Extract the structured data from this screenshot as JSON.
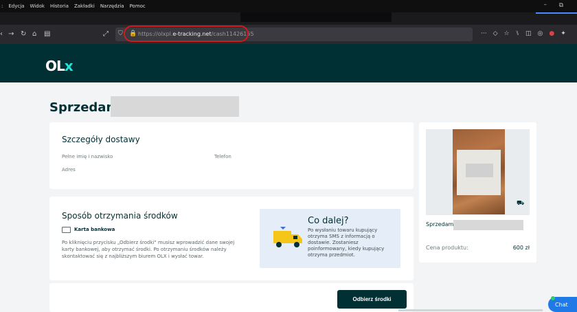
{
  "menubar": {
    "items": [
      ":",
      "Edycja",
      "Widok",
      "Historia",
      "Zakładki",
      "Narzędzia",
      "Pomoc"
    ]
  },
  "browser": {
    "url_prefix": "https://olxpl.",
    "url_domain": "e-tracking.net",
    "url_path": "/cash11426155"
  },
  "brand": {
    "logo_main": "OL",
    "logo_accent": "x"
  },
  "page": {
    "title": "Sprzedam"
  },
  "delivery": {
    "title": "Szczegóły dostawy",
    "fullname_label": "Pełne imię i nazwisko",
    "phone_label": "Telefon",
    "address_label": "Adres"
  },
  "payment": {
    "title": "Sposób otrzymania środków",
    "method_label": "Karta bankowa",
    "description": "Po kliknięciu przycisku „Odbierz środki\" musisz wprowadzić dane swojej karty bankowej, aby otrzymać środki. Po otrzymaniu środków należy skontaktować się z najbliższym biurem OLX i wysłać towar."
  },
  "next": {
    "title": "Co dalej?",
    "text": "Po wysłaniu towaru kupujący otrzyma SMS z informacją o dostawie. Zostaniesz poinformowany, kiedy kupujący otrzyma przedmiot."
  },
  "product": {
    "name": "Sprzedam",
    "price_label": "Cena produktu:",
    "price_value": "600 zł"
  },
  "actions": {
    "collect_label": "Odbierz środki",
    "chat_label": "Chat"
  },
  "colors": {
    "brand_dark": "#002f34",
    "brand_accent": "#23e5db",
    "info_bg": "#e5eef8",
    "highlight_circle": "#d11a1a"
  }
}
